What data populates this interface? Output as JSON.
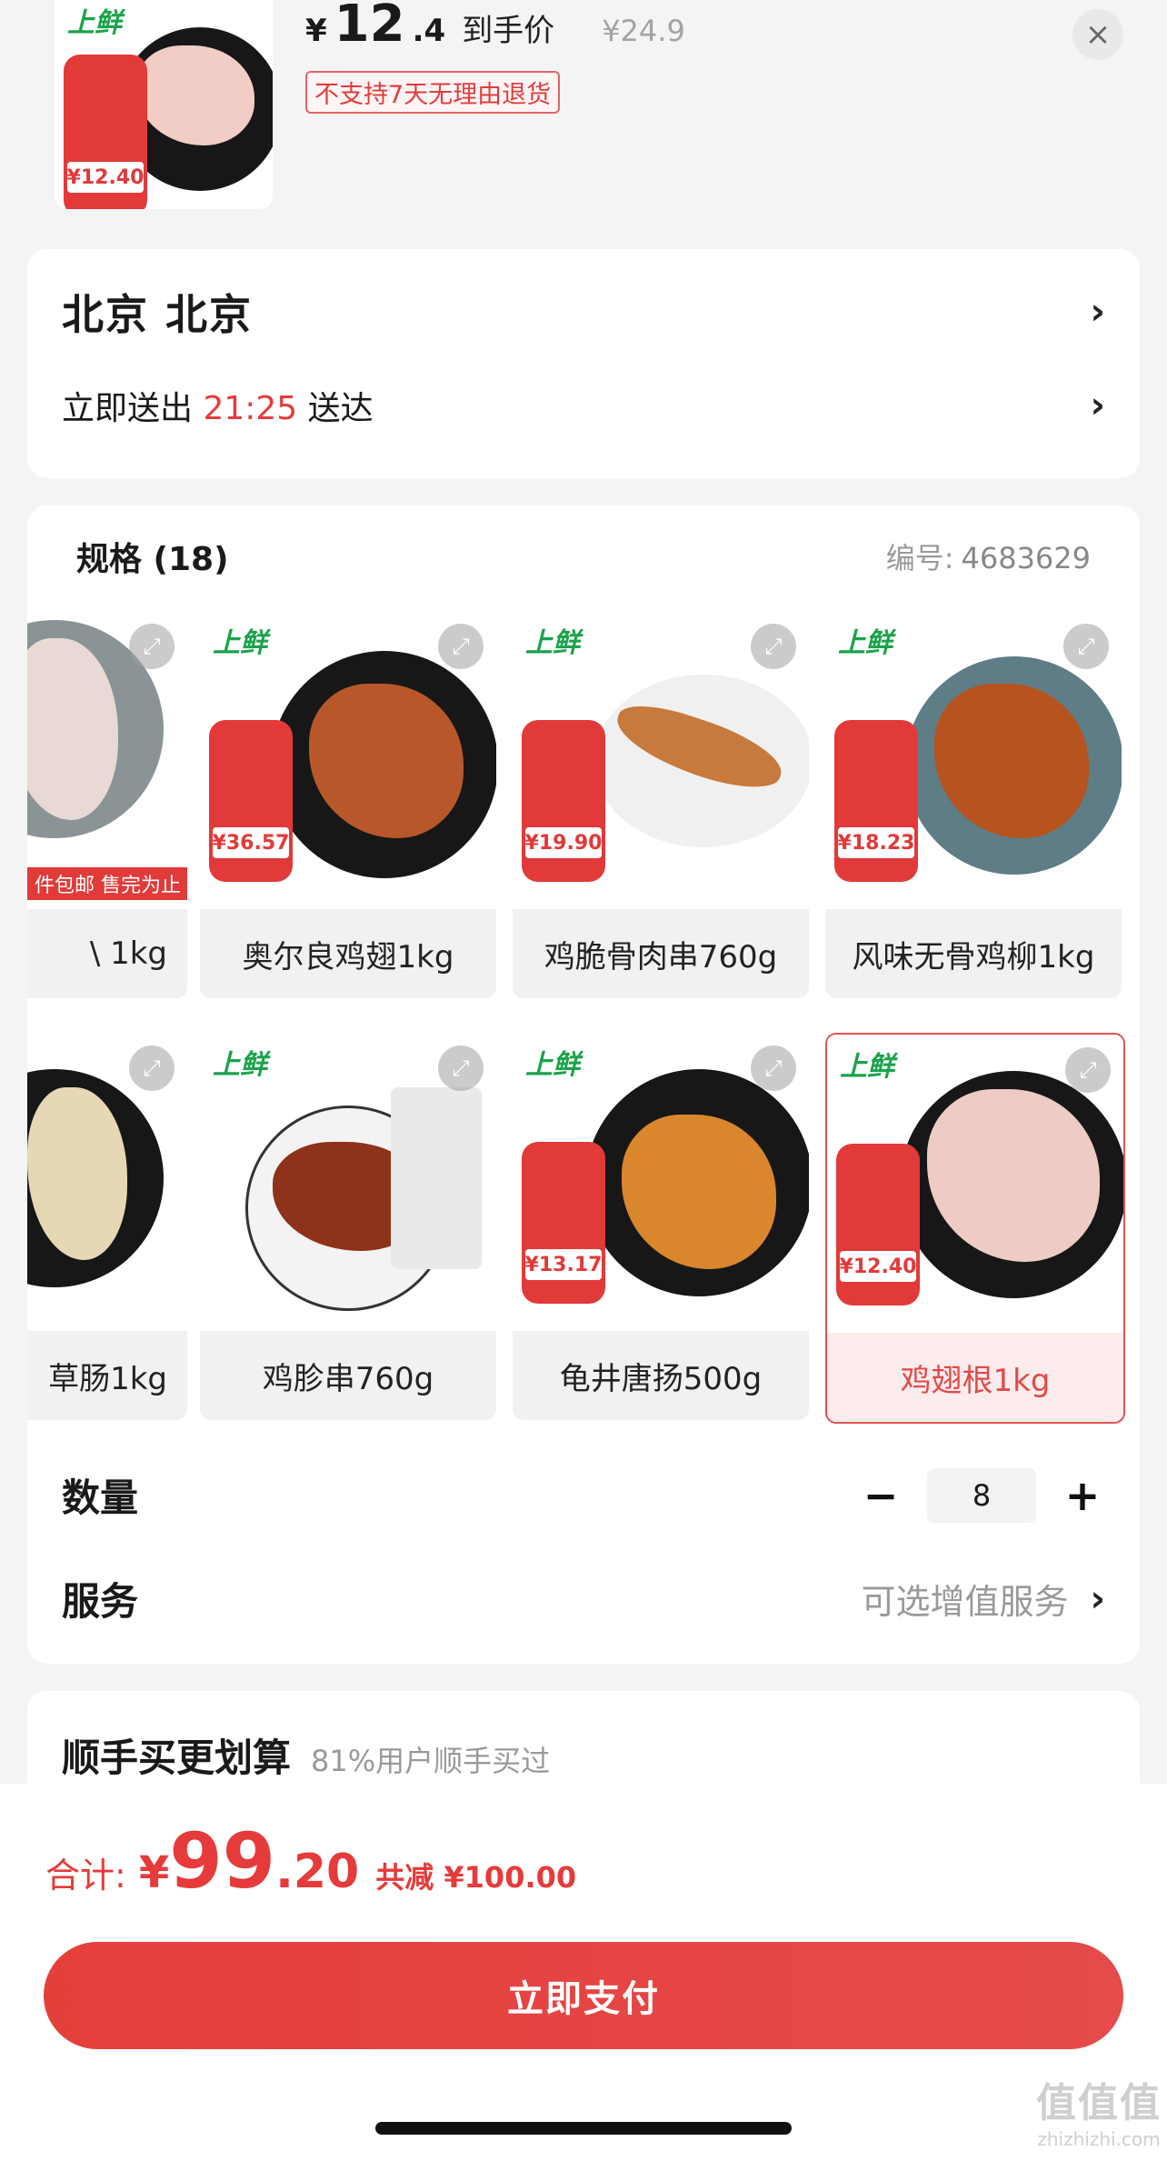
{
  "header": {
    "currency": "¥",
    "price_int": "12",
    "price_dec": ".4",
    "price_label": "到手价",
    "original_price": "¥24.9",
    "return_policy": "不支持7天无理由退货",
    "close_icon": "×",
    "thumb_brand": "上鲜",
    "thumb_price": "¥12.40"
  },
  "address": {
    "location": "北京  北京",
    "deliver_prefix": "立即送出",
    "deliver_time": "21:25",
    "deliver_suffix": "送达",
    "chevron": "›"
  },
  "spec": {
    "title": "规格 (18)",
    "number_label": "编号:",
    "number_value": "4683629",
    "items": [
      {
        "name": "\\ 1kg",
        "brand": "",
        "price": "",
        "banner": "件包邮  售完为止"
      },
      {
        "name": "奥尔良鸡翅1kg",
        "brand": "上鲜",
        "price": "¥36.57"
      },
      {
        "name": "鸡脆骨肉串760g",
        "brand": "上鲜",
        "price": "¥19.90"
      },
      {
        "name": "风味无骨鸡柳1kg",
        "brand": "上鲜",
        "price": "¥18.23"
      },
      {
        "name": "草肠1kg",
        "brand": "",
        "price": ""
      },
      {
        "name": "鸡胗串760g",
        "brand": "上鲜",
        "price": ""
      },
      {
        "name": "龟井唐扬500g",
        "brand": "上鲜",
        "price": "¥13.17"
      },
      {
        "name": "鸡翅根1kg",
        "brand": "上鲜",
        "price": "¥12.40",
        "selected": true
      }
    ],
    "expand_icon": "⤢"
  },
  "quantity": {
    "label": "数量",
    "value": "8",
    "minus": "−",
    "plus": "+"
  },
  "service": {
    "label": "服务",
    "value": "可选增值服务",
    "chevron": "›"
  },
  "more": {
    "title": "顺手买更划算",
    "subtitle": "81%用户顺手买过"
  },
  "total": {
    "label": "合计:",
    "yen": "¥",
    "int": "99",
    "dec": ".20",
    "saved": "共减 ¥100.00"
  },
  "pay_button": "立即支付",
  "watermark": {
    "main": "值值值",
    "sub": "zhizhizhi.com"
  },
  "colors": {
    "accent": "#e53b3b",
    "brand_green": "#1aa34a"
  }
}
